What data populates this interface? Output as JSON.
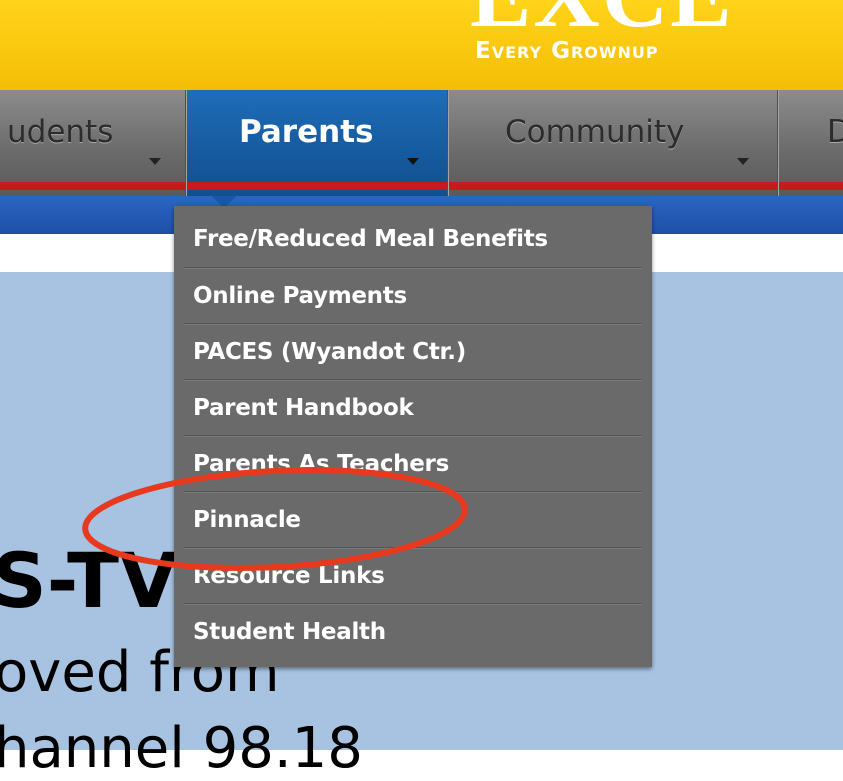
{
  "banner": {
    "headline": "EXCE",
    "tagline": "Every Grownup"
  },
  "nav": {
    "items": [
      {
        "label": "udents",
        "active": false
      },
      {
        "label": "Parents",
        "active": true
      },
      {
        "label": "Community",
        "active": false
      },
      {
        "label": "D",
        "active": false
      }
    ]
  },
  "dropdown": {
    "items": [
      {
        "label": "Free/Reduced Meal Benefits"
      },
      {
        "label": "Online Payments"
      },
      {
        "label": "PACES (Wyandot Ctr.)"
      },
      {
        "label": "Parent Handbook"
      },
      {
        "label": "Parents As Teachers"
      },
      {
        "label": "Pinnacle"
      },
      {
        "label": "Resource Links"
      },
      {
        "label": "Student Health"
      }
    ],
    "highlighted_item": "Pinnacle"
  },
  "content": {
    "line1": "S-TV",
    "line2": "oved from",
    "line3": "hannel 98.18"
  },
  "colors": {
    "banner": "#f4bd06",
    "nav_active": "#155a9f",
    "nav_redline": "#c51b1b",
    "dropdown_bg": "#6a6a6a",
    "content_bg": "#a7c3e1",
    "annotation": "#e8391f"
  }
}
